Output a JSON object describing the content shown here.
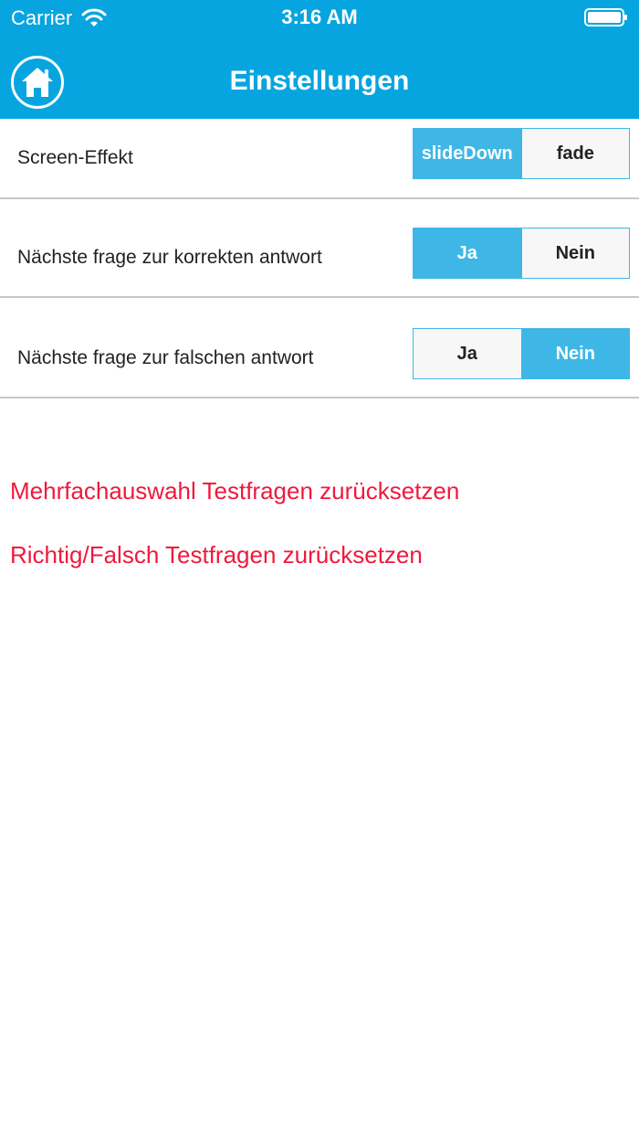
{
  "status_bar": {
    "carrier": "Carrier",
    "time": "3:16 AM"
  },
  "header": {
    "title": "Einstellungen",
    "home_icon": "home-icon"
  },
  "colors": {
    "accent": "#07a5df",
    "segment_active": "#3fb7e6",
    "danger": "#f0193d"
  },
  "settings": [
    {
      "label": "Screen-Effekt",
      "options": [
        "slideDown",
        "fade"
      ],
      "selected": "slideDown"
    },
    {
      "label": "Nächste frage zur korrekten antwort",
      "options": [
        "Ja",
        "Nein"
      ],
      "selected": "Ja"
    },
    {
      "label": "Nächste frage zur falschen antwort",
      "options": [
        "Ja",
        "Nein"
      ],
      "selected": "Nein"
    }
  ],
  "actions": {
    "reset_multiple_choice": "Mehrfachauswahl Testfragen zurücksetzen",
    "reset_true_false": "Richtig/Falsch Testfragen zurücksetzen"
  }
}
